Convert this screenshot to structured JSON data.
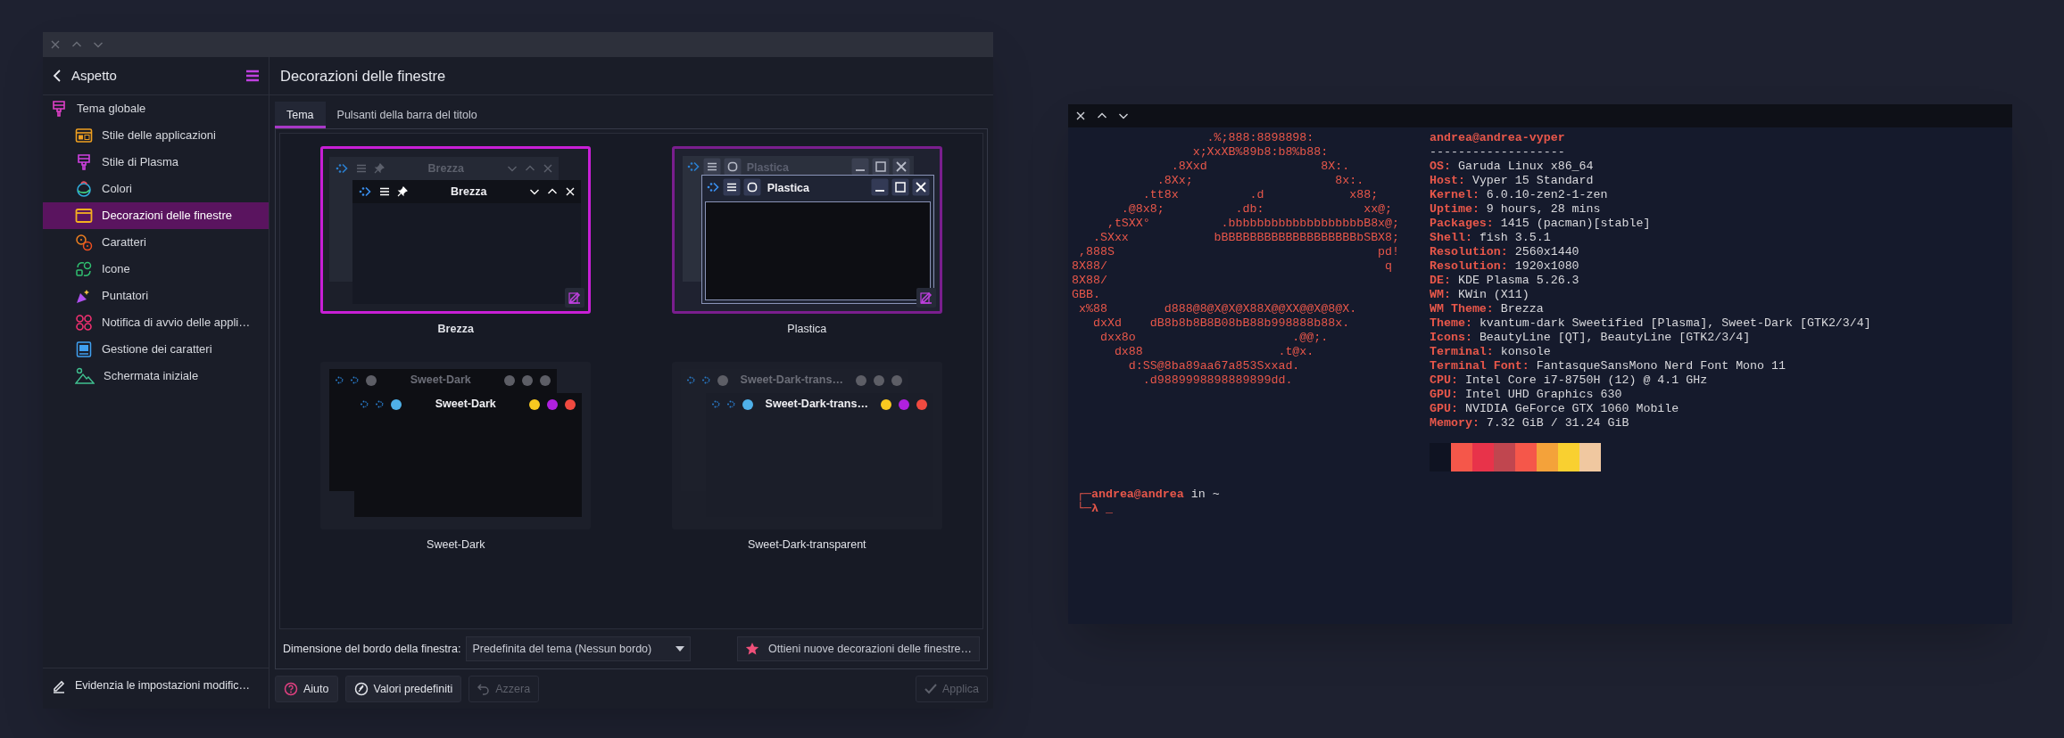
{
  "settings_window": {
    "sidebar": {
      "title": "Aspetto",
      "items": [
        {
          "label": "Tema globale",
          "selected": false,
          "children": [
            {
              "label": "Stile delle applicazioni",
              "selected": false
            },
            {
              "label": "Stile di Plasma",
              "selected": false
            },
            {
              "label": "Colori",
              "selected": false
            },
            {
              "label": "Decorazioni delle finestre",
              "selected": true
            },
            {
              "label": "Caratteri",
              "selected": false
            },
            {
              "label": "Icone",
              "selected": false
            },
            {
              "label": "Puntatori",
              "selected": false
            },
            {
              "label": "Notifica di avvio delle appli…",
              "selected": false
            },
            {
              "label": "Gestione dei caratteri",
              "selected": false
            },
            {
              "label": "Schermata iniziale",
              "selected": false
            }
          ]
        }
      ],
      "footer": "Evidenzia le impostazioni modific…"
    },
    "page": {
      "title": "Decorazioni delle finestre",
      "tabs": [
        {
          "label": "Tema",
          "selected": true
        },
        {
          "label": "Pulsanti della barra del titolo",
          "selected": false
        }
      ],
      "themes": [
        {
          "kind": "brezza",
          "name": "Brezza",
          "outer_title": "Brezza",
          "inner_title": "Brezza",
          "selected": true,
          "hovered": false
        },
        {
          "kind": "plastica",
          "name": "Plastica",
          "outer_title": "Plastica",
          "inner_title": "Plastica",
          "selected": false,
          "hovered": true
        },
        {
          "kind": "sweet",
          "name": "Sweet-Dark",
          "outer_title": "Sweet-Dark",
          "inner_title": "Sweet-Dark",
          "selected": false,
          "hovered": false
        },
        {
          "kind": "sweet_transparent",
          "name": "Sweet-Dark-transparent",
          "outer_title": "Sweet-Dark-trans…",
          "inner_title": "Sweet-Dark-trans…",
          "selected": false,
          "hovered": false
        }
      ],
      "border_size": {
        "label": "Dimensione del bordo della finestra:",
        "value": "Predefinita del tema (Nessun bordo)"
      },
      "get_new_button": "Ottieni nuove decorazioni delle finestre…"
    },
    "buttons": [
      {
        "kind": "help",
        "label": "Aiuto",
        "disabled": false
      },
      {
        "kind": "defaults",
        "label": "Valori predefiniti",
        "disabled": false
      },
      {
        "kind": "reset",
        "label": "Azzera",
        "disabled": true
      },
      {
        "kind": "apply",
        "label": "Applica",
        "disabled": true
      }
    ]
  },
  "terminal": {
    "ascii_art": [
      "                   .%;888:8898898:",
      "                 x;XxXB%89b8:b8%b88:",
      "              .8Xxd                8X:.",
      "            .8Xx;                    8x:.",
      "          .tt8x          .d            x88;",
      "       .@8x8;          .db:              xx@;",
      "     ,tSXX°          .bbbbbbbbbbbbbbbbbbbB8x@;",
      "   .SXxx            bBBBBBBBBBBBBBBBBBBBbSBX8;",
      " ,888S                                     pd!",
      "8X88/                                       q",
      "8X88/",
      "GBB.",
      " x%88        d888@8@X@X@X88X@@XX@@X@8@X.",
      "   dxXd    dB8b8b8B8B08bB88b998888b88x.",
      "    dxx8o                      .@@;.",
      "      dx88                   .t@x.",
      "        d:SS@8ba89aa67a853Sxxad.",
      "          .d9889998898889899dd."
    ],
    "user_host": "andrea@andrea-vyper",
    "separator": "-------------------",
    "info": [
      {
        "key": "OS:",
        "value": "Garuda Linux x86_64"
      },
      {
        "key": "Host:",
        "value": "Vyper 15 Standard"
      },
      {
        "key": "Kernel:",
        "value": "6.0.10-zen2-1-zen"
      },
      {
        "key": "Uptime:",
        "value": "9 hours, 28 mins"
      },
      {
        "key": "Packages:",
        "value": "1415 (pacman)[stable]"
      },
      {
        "key": "Shell:",
        "value": "fish 3.5.1"
      },
      {
        "key": "Resolution:",
        "value": "2560x1440"
      },
      {
        "key": "Resolution:",
        "value": "1920x1080"
      },
      {
        "key": "DE:",
        "value": "KDE Plasma 5.26.3"
      },
      {
        "key": "WM:",
        "value": "KWin (X11)"
      },
      {
        "key": "WM Theme:",
        "value": "Brezza"
      },
      {
        "key": "Theme:",
        "value": "kvantum-dark Sweetified [Plasma], Sweet-Dark [GTK2/3/4]"
      },
      {
        "key": "Icons:",
        "value": "BeautyLine [QT], BeautyLine [GTK2/3/4]"
      },
      {
        "key": "Terminal:",
        "value": "konsole"
      },
      {
        "key": "Terminal Font:",
        "value": "FantasqueSansMono Nerd Font Mono 11"
      },
      {
        "key": "CPU:",
        "value": "Intel Core i7-8750H (12) @ 4.1 GHz"
      },
      {
        "key": "GPU:",
        "value": "Intel UHD Graphics 630"
      },
      {
        "key": "GPU:",
        "value": "NVIDIA GeForce GTX 1060 Mobile"
      },
      {
        "key": "Memory:",
        "value": "7.32 GiB / 31.24 GiB"
      }
    ],
    "palette": [
      {
        "color": "#0f1322"
      },
      {
        "color": "#f5574a"
      },
      {
        "color": "#e8334a"
      },
      {
        "color": "#c0464f"
      },
      {
        "color": "#f5574a"
      },
      {
        "color": "#f4a23a"
      },
      {
        "color": "#f9d030"
      },
      {
        "color": "#f0c8a0"
      }
    ],
    "prompt": {
      "corner_top": "┌─",
      "user": "andrea@andrea",
      "word": "in",
      "path": "~",
      "corner_bottom": "└─",
      "symbol": "λ",
      "cursor": "_"
    }
  }
}
